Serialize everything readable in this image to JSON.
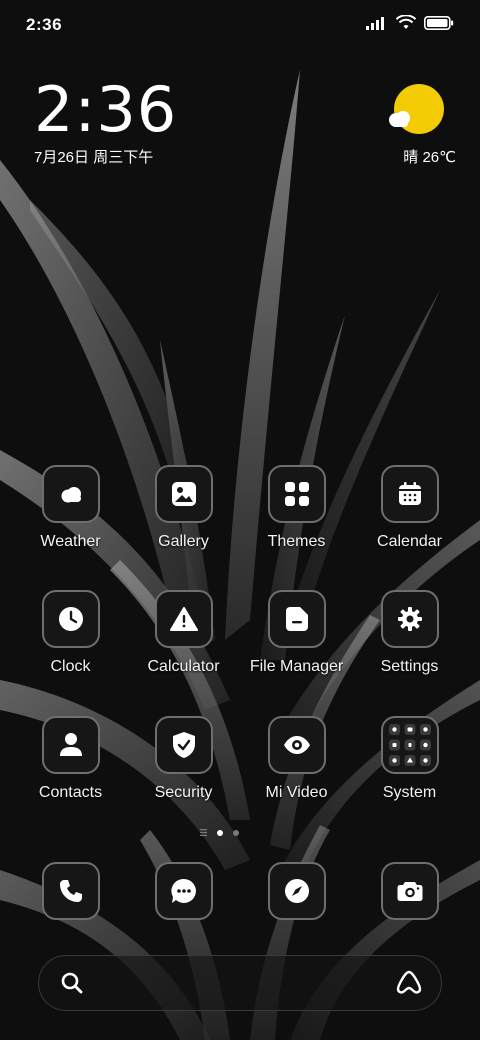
{
  "status_bar": {
    "time": "2:36"
  },
  "clock_widget": {
    "time": "2:36",
    "date": "7月26日 周三下午"
  },
  "weather_widget": {
    "text": "晴 26℃",
    "sun_color": "#f2cb05"
  },
  "apps": [
    {
      "label": "Weather",
      "icon": "weather-icon"
    },
    {
      "label": "Gallery",
      "icon": "gallery-icon"
    },
    {
      "label": "Themes",
      "icon": "themes-icon"
    },
    {
      "label": "Calendar",
      "icon": "calendar-icon"
    },
    {
      "label": "Clock",
      "icon": "clock-icon"
    },
    {
      "label": "Calculator",
      "icon": "calculator-icon"
    },
    {
      "label": "File Manager",
      "icon": "file-manager-icon"
    },
    {
      "label": "Settings",
      "icon": "settings-icon"
    },
    {
      "label": "Contacts",
      "icon": "contacts-icon"
    },
    {
      "label": "Security",
      "icon": "security-icon"
    },
    {
      "label": "Mi Video",
      "icon": "mi-video-icon"
    },
    {
      "label": "System",
      "icon": "system-folder-icon"
    }
  ],
  "dock": [
    {
      "icon": "phone-icon"
    },
    {
      "icon": "messages-icon"
    },
    {
      "icon": "browser-icon"
    },
    {
      "icon": "camera-icon"
    }
  ],
  "page_indicator": {
    "current_page": 1,
    "total_pages": 2
  },
  "search_bar": {
    "left_icon": "search-icon",
    "right_icon": "assistant-icon"
  }
}
